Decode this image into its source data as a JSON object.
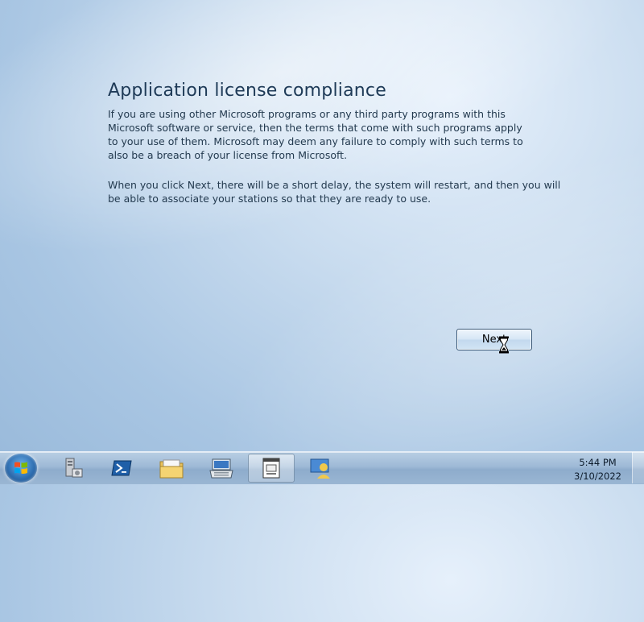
{
  "heading": "Application license compliance",
  "paragraph1": "If you are using other Microsoft programs or any third party programs with this Microsoft software or service, then the terms that come with such programs apply to your use of them.  Microsoft may deem any failure to comply with such terms to also be a breach of your license from Microsoft.",
  "paragraph2": "When you click Next, there will be a short delay, the system will restart, and then you will be able to associate your stations so that they are ready to use.",
  "next_button": "Next",
  "taskbar": {
    "items": [
      {
        "icon": "server-manager-icon"
      },
      {
        "icon": "powershell-icon"
      },
      {
        "icon": "explorer-folder-icon"
      },
      {
        "icon": "keyboard-settings-icon"
      },
      {
        "icon": "application-window-icon",
        "active": true
      },
      {
        "icon": "user-management-icon"
      }
    ],
    "time": "5:44 PM",
    "date": "3/10/2022"
  }
}
